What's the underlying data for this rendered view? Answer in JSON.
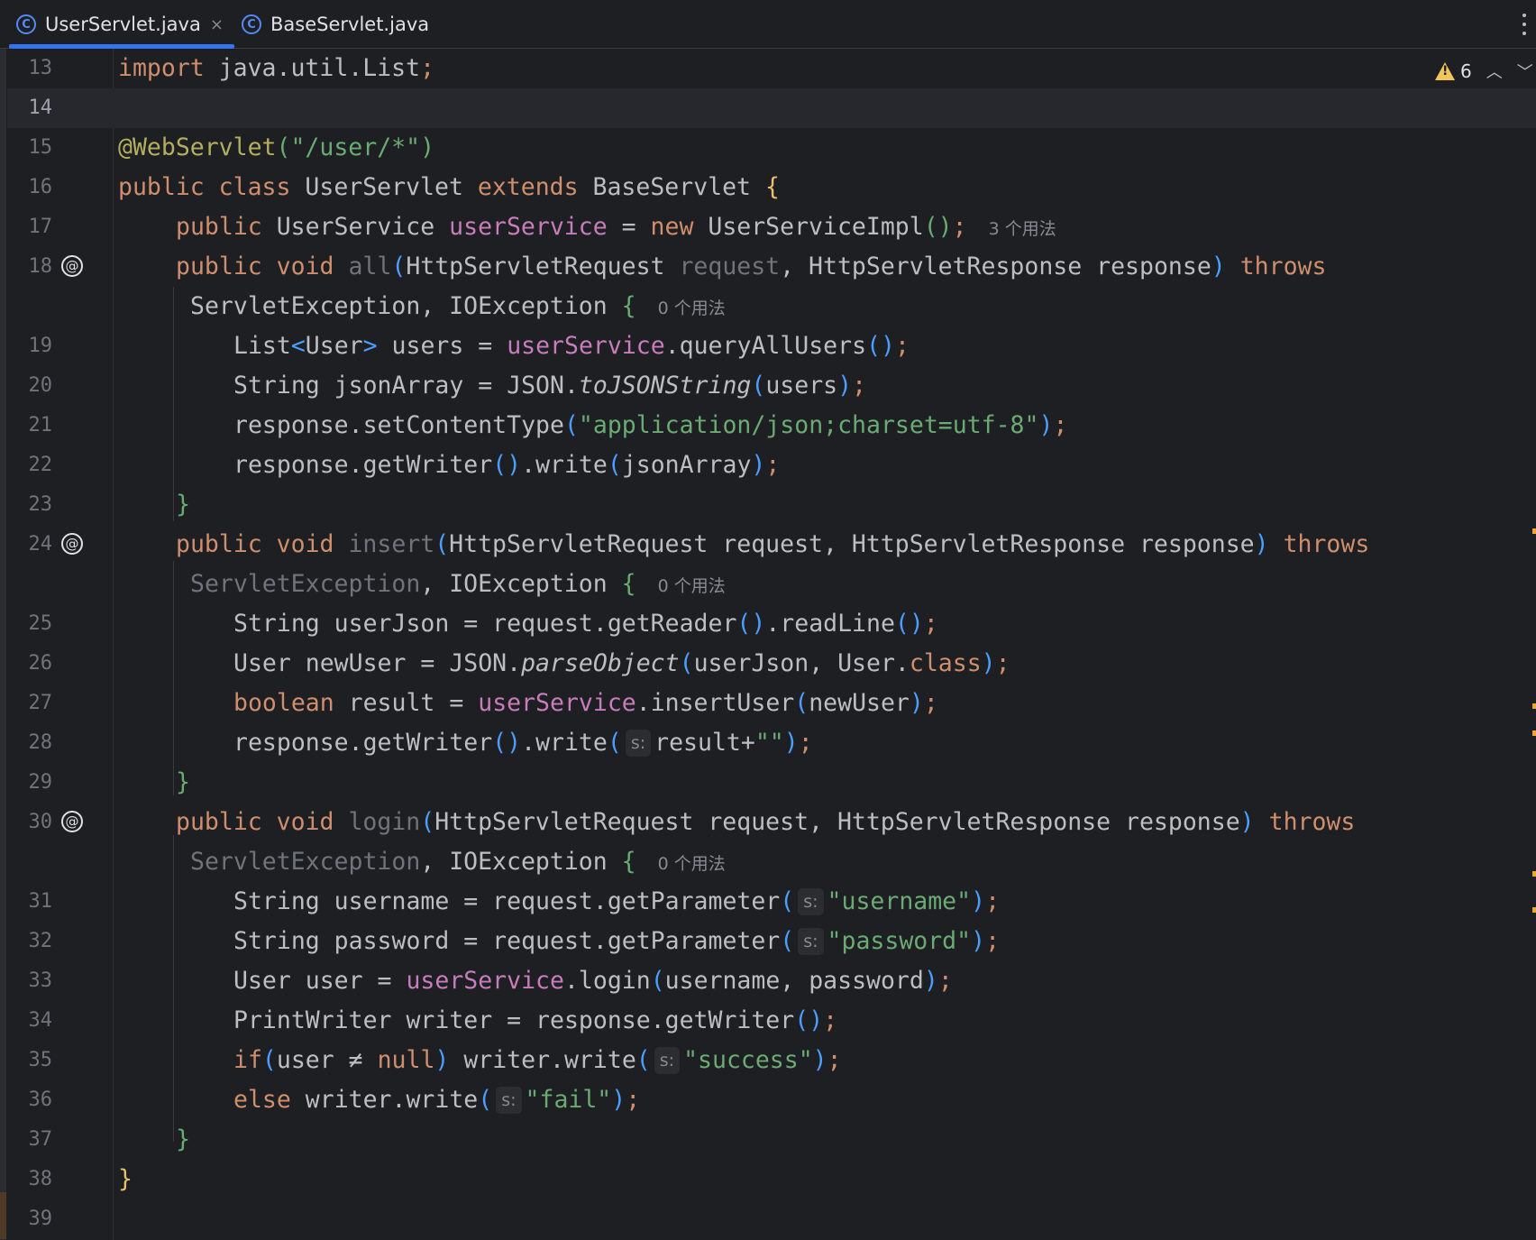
{
  "tabs": [
    {
      "label": "UserServlet.java",
      "icon": "c-class-icon",
      "active": true,
      "close": "×"
    },
    {
      "label": "BaseServlet.java",
      "icon": "c-class-icon",
      "active": false
    }
  ],
  "inspection": {
    "warning_count": "6"
  },
  "usage_hints": {
    "h17": "3 个用法",
    "h18": "0 个用法",
    "h24": "0 个用法",
    "h30": "0 个用法"
  },
  "param_hint": "s:",
  "line_numbers": [
    "13",
    "14",
    "15",
    "16",
    "17",
    "18",
    "19",
    "20",
    "21",
    "22",
    "23",
    "24",
    "25",
    "26",
    "27",
    "28",
    "29",
    "30",
    "31",
    "32",
    "33",
    "34",
    "35",
    "36",
    "37",
    "38",
    "39"
  ],
  "code": {
    "l13": "import java.util.List;",
    "l15": "@WebServlet(\"/user/*\")",
    "l16": "public class UserServlet extends BaseServlet {",
    "l17": "public UserService userService = new UserServiceImpl();",
    "l18": "public void all(HttpServletRequest request, HttpServletResponse response) throws",
    "l18b": "ServletException, IOException {",
    "l19": "List<User> users = userService.queryAllUsers();",
    "l20": "String jsonArray = JSON.toJSONString(users);",
    "l21": "response.setContentType(\"application/json;charset=utf-8\");",
    "l22": "response.getWriter().write(jsonArray);",
    "l23": "}",
    "l24": "public void insert(HttpServletRequest request, HttpServletResponse response) throws",
    "l24b": "ServletException, IOException {",
    "l25": "String userJson = request.getReader().readLine();",
    "l26": "User newUser = JSON.parseObject(userJson, User.class);",
    "l27": "boolean result = userService.insertUser(newUser);",
    "l28": "response.getWriter().write(result+\"\");",
    "l29": "}",
    "l30": "public void login(HttpServletRequest request, HttpServletResponse response) throws",
    "l30b": "ServletException, IOException {",
    "l31": "String username = request.getParameter(\"username\");",
    "l32": "String password = request.getParameter(\"password\");",
    "l33": "User user = userService.login(username, password);",
    "l34": "PrintWriter writer = response.getWriter();",
    "l35": "if(user ≠ null) writer.write(\"success\");",
    "l36": "else writer.write(\"fail\");",
    "l37": "}",
    "l38": "}"
  },
  "colors": {
    "background": "#1e1f22",
    "keyword": "#cf8e6d",
    "string": "#6aab73",
    "annotation": "#b3ae60",
    "field": "#c77dbb",
    "method": "#56a8f5",
    "tab_underline": "#3574f0",
    "warning": "#f2c55c"
  }
}
